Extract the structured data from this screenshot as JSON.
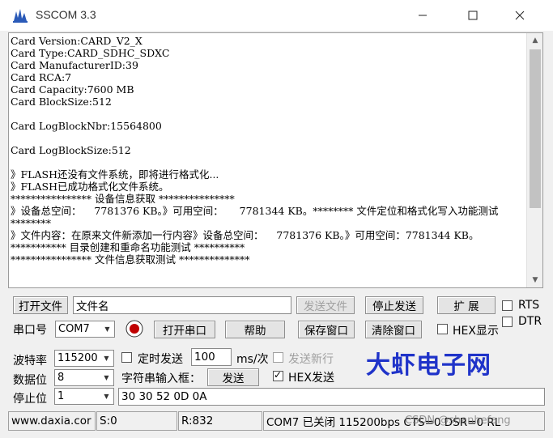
{
  "window": {
    "title": "SSCOM 3.3"
  },
  "terminal": {
    "text": "Card Version:CARD_V2_X\nCard Type:CARD_SDHC_SDXC\nCard ManufacturerID:39\nCard RCA:7\nCard Capacity:7600 MB\nCard BlockSize:512\n\nCard LogBlockNbr:15564800\n\nCard LogBlockSize:512\n\n》FLASH还没有文件系统，即将进行格式化...\n》FLASH已成功格式化文件系统。\n**************** 设备信息获取 ***************\n》设备总空间：    7781376 KB。》可用空间：     7781344 KB。******** 文件定位和格式化写入功能测试 ********\n》文件内容：在原来文件新添加一行内容》设备总空间：    7781376 KB。》可用空间：7781344 KB。\n*********** 目录创建和重命名功能测试 **********\n**************** 文件信息获取测试 **************"
  },
  "row1": {
    "open_file": "打开文件",
    "file_name": "文件名",
    "send_file": "发送文件",
    "stop_send": "停止发送",
    "expand": "扩 展",
    "rts": "RTS",
    "dtr": "DTR"
  },
  "row2": {
    "port_label": "串口号",
    "port_value": "COM7",
    "open_port": "打开串口",
    "help": "帮助",
    "save_window": "保存窗口",
    "clear_window": "清除窗口",
    "hex_display": "HEX显示"
  },
  "settings": {
    "baud_label": "波特率",
    "baud_value": "115200",
    "data_label": "数据位",
    "data_value": "8",
    "stop_label": "停止位",
    "stop_value": "1",
    "timed_send": "定时发送",
    "interval_value": "100",
    "interval_unit": "ms/次",
    "send_newline": "发送新行",
    "string_input_label": "字符串输入框：",
    "send": "发送",
    "hex_send": "HEX发送",
    "input_value": "30 30 52 0D 0A"
  },
  "brand": "大虾电子网",
  "statusbar": {
    "website": "www.daxia.cor",
    "sent": "S:0",
    "received": "R:832",
    "port_status": "COM7 已关闭  115200bps  CTS=0 DSR=0 RL",
    "watermark": "CSDN @shanhefang"
  },
  "colors": {
    "brand": "#1f33c9",
    "record_red": "#c00000"
  }
}
